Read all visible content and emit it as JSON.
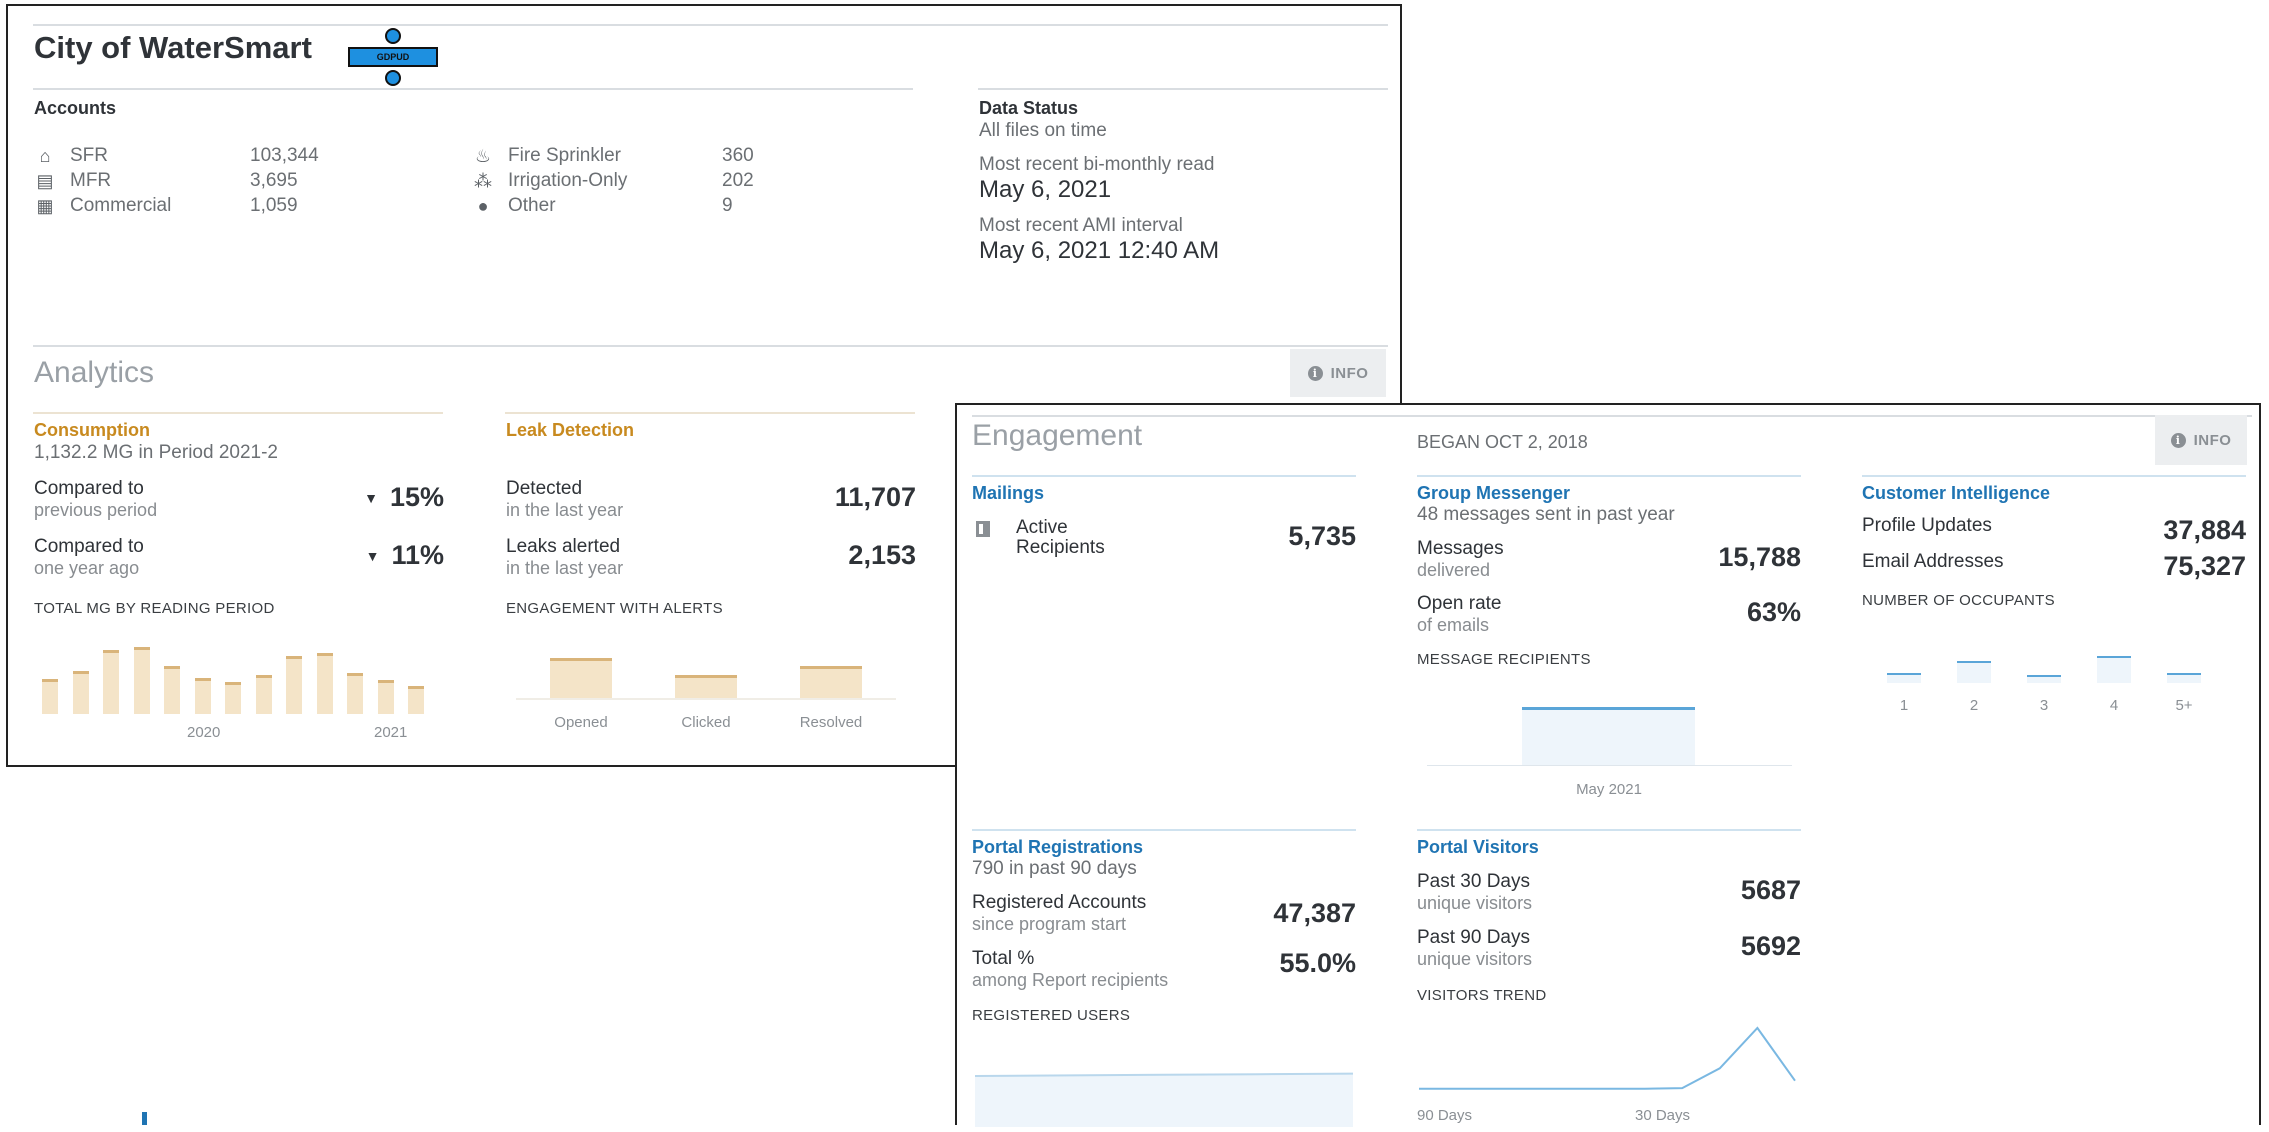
{
  "header": {
    "title": "City of WaterSmart",
    "logo_text": "GDPUD"
  },
  "accounts": {
    "heading": "Accounts",
    "left": [
      {
        "icon": "house-icon",
        "label": "SFR",
        "value": "103,344"
      },
      {
        "icon": "building-icon",
        "label": "MFR",
        "value": "3,695"
      },
      {
        "icon": "store-icon",
        "label": "Commercial",
        "value": "1,059"
      }
    ],
    "right": [
      {
        "icon": "fire-icon",
        "label": "Fire Sprinkler",
        "value": "360"
      },
      {
        "icon": "sprinkler-icon",
        "label": "Irrigation-Only",
        "value": "202"
      },
      {
        "icon": "droplet-icon",
        "label": "Other",
        "value": "9"
      }
    ]
  },
  "data_status": {
    "heading": "Data Status",
    "status": "All files on time",
    "bimonthly_label": "Most recent bi-monthly read",
    "bimonthly_value": "May 6, 2021",
    "ami_label": "Most recent AMI interval",
    "ami_value": "May 6, 2021 12:40 AM"
  },
  "analytics": {
    "heading": "Analytics",
    "info": "INFO",
    "consumption": {
      "heading": "Consumption",
      "sub": "1,132.2 MG in Period 2021-2",
      "rows": [
        {
          "label": "Compared to",
          "sub": "previous period",
          "arrow": "▼",
          "value": "15%"
        },
        {
          "label": "Compared to",
          "sub": "one year ago",
          "arrow": "▼",
          "value": "11%"
        }
      ],
      "chart_caption": "TOTAL MG BY READING PERIOD"
    },
    "leak": {
      "heading": "Leak Detection",
      "rows": [
        {
          "label": "Detected",
          "sub": "in the last year",
          "value": "11,707"
        },
        {
          "label": "Leaks alerted",
          "sub": "in the last year",
          "value": "2,153"
        }
      ],
      "chart_caption": "ENGAGEMENT WITH ALERTS"
    }
  },
  "engagement": {
    "heading": "Engagement",
    "began": "BEGAN OCT 2, 2018",
    "info": "INFO",
    "mailings": {
      "heading": "Mailings",
      "label1": "Active",
      "label2": "Recipients",
      "value": "5,735"
    },
    "group_messenger": {
      "heading": "Group Messenger",
      "sub": "48 messages sent in past year",
      "rows": [
        {
          "label": "Messages",
          "sub": "delivered",
          "value": "15,788"
        },
        {
          "label": "Open rate",
          "sub": "of emails",
          "value": "63%"
        }
      ],
      "chart_caption": "MESSAGE RECIPIENTS"
    },
    "customer_intelligence": {
      "heading": "Customer Intelligence",
      "rows": [
        {
          "label": "Profile Updates",
          "value": "37,884"
        },
        {
          "label": "Email Addresses",
          "value": "75,327"
        }
      ],
      "chart_caption": "NUMBER OF OCCUPANTS"
    },
    "portal_registrations": {
      "heading": "Portal Registrations",
      "sub": "790 in past 90 days",
      "rows": [
        {
          "label": "Registered Accounts",
          "sub": "since program start",
          "value": "47,387"
        },
        {
          "label": "Total %",
          "sub": "among Report recipients",
          "value": "55.0%"
        }
      ],
      "chart_caption": "REGISTERED USERS"
    },
    "portal_visitors": {
      "heading": "Portal Visitors",
      "rows": [
        {
          "label": "Past 30 Days",
          "sub": "unique visitors",
          "value": "5687"
        },
        {
          "label": "Past 90 Days",
          "sub": "unique visitors",
          "value": "5692"
        }
      ],
      "chart_caption": "VISITORS TREND"
    }
  },
  "chart_data": [
    {
      "id": "total_mg",
      "type": "bar",
      "categories": [
        "",
        "",
        "",
        "",
        "",
        "",
        "",
        "",
        "",
        "",
        "",
        "",
        ""
      ],
      "values": [
        0.5,
        0.62,
        0.92,
        0.95,
        0.68,
        0.52,
        0.45,
        0.56,
        0.83,
        0.87,
        0.59,
        0.48,
        0.4
      ],
      "tick_labels": [
        "2020",
        "2021"
      ],
      "colors": {
        "fill": "#f4e4c8",
        "line": "#d9b47a"
      }
    },
    {
      "id": "engagement_alerts",
      "type": "bar",
      "categories": [
        "Opened",
        "Clicked",
        "Resolved"
      ],
      "values": [
        0.95,
        0.55,
        0.75
      ]
    },
    {
      "id": "message_recipients",
      "type": "bar",
      "categories": [
        "May 2021"
      ],
      "values": [
        1.0
      ]
    },
    {
      "id": "occupants",
      "type": "bar",
      "categories": [
        "1",
        "2",
        "3",
        "4",
        "5+"
      ],
      "values": [
        0.35,
        0.78,
        0.3,
        0.95,
        0.35
      ]
    },
    {
      "id": "registered_users",
      "type": "area",
      "values": [
        0.88,
        0.89,
        0.9,
        0.91,
        0.92
      ]
    },
    {
      "id": "visitors_trend",
      "type": "line",
      "x_labels": [
        "90 Days",
        "30 Days"
      ],
      "values": [
        0.02,
        0.02,
        0.02,
        0.02,
        0.02,
        0.02,
        0.02,
        0.03,
        0.35,
        1.0,
        0.15
      ]
    }
  ]
}
